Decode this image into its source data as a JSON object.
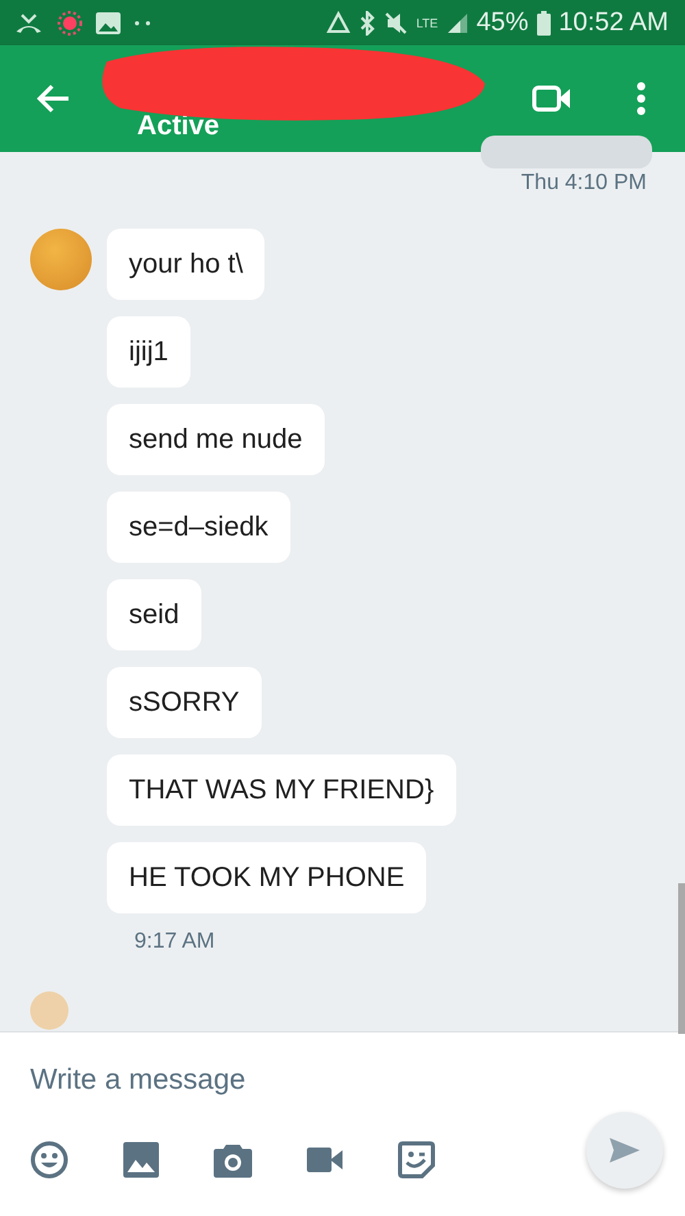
{
  "status_bar": {
    "network": "LTE",
    "battery": "45%",
    "time": "10:52 AM"
  },
  "header": {
    "subtitle": "Active"
  },
  "conversation": {
    "previous_time": "Thu 4:10 PM",
    "messages": [
      {
        "text": "your ho t\\"
      },
      {
        "text": "ijij1"
      },
      {
        "text": "send me nude"
      },
      {
        "text": "se=d–siedk"
      },
      {
        "text": "seid"
      },
      {
        "text": "sSORRY"
      },
      {
        "text": "THAT WAS MY FRIEND}"
      },
      {
        "text": "HE TOOK MY PHONE"
      }
    ],
    "time": "9:17 AM"
  },
  "composer": {
    "placeholder": "Write a message"
  }
}
